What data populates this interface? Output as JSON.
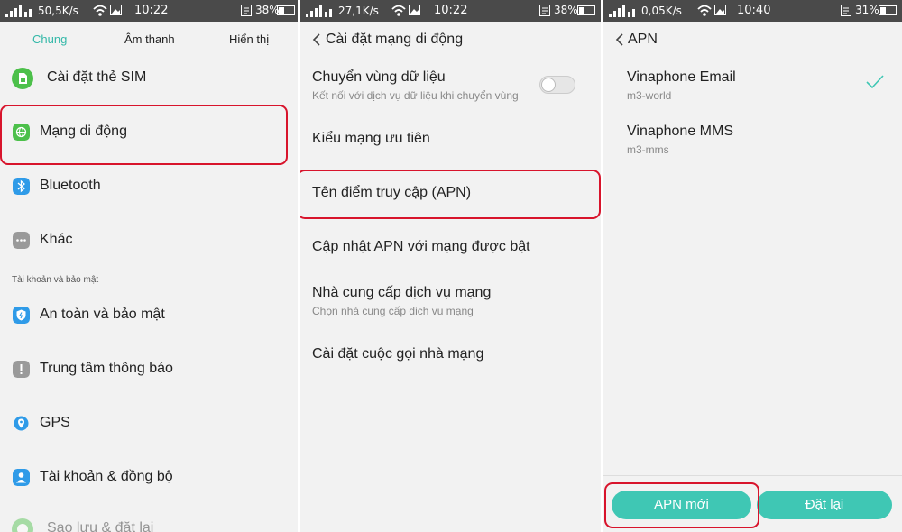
{
  "panels": [
    {
      "status": {
        "net": "50,5K/s",
        "time": "10:22",
        "battery": "38%"
      },
      "tabs": [
        {
          "label": "Chung",
          "active": true
        },
        {
          "label": "Âm thanh",
          "active": false
        },
        {
          "label": "Hiển thị",
          "active": false
        }
      ],
      "items": [
        {
          "label": "Cài đặt thẻ SIM",
          "icon": "sim-icon",
          "color": "#4cc04a"
        },
        {
          "label": "Mạng di động",
          "icon": "globe-icon",
          "color": "#4cc04a"
        },
        {
          "label": "Bluetooth",
          "icon": "bluetooth-icon",
          "color": "#2f9be8"
        },
        {
          "label": "Khác",
          "icon": "more-icon",
          "color": "#9a9a9a"
        }
      ],
      "section_header": "Tài khoản và bảo mật",
      "items2": [
        {
          "label": "An toàn và bảo mật",
          "icon": "shield-icon",
          "color": "#2f9be8"
        },
        {
          "label": "Trung tâm thông báo",
          "icon": "notice-icon",
          "color": "#9a9a9a"
        },
        {
          "label": "GPS",
          "icon": "location-icon",
          "color": "#2f9be8"
        },
        {
          "label": "Tài khoản & đồng bộ",
          "icon": "account-icon",
          "color": "#2f9be8"
        },
        {
          "label": "Sao lưu & đặt lại",
          "icon": "backup-icon",
          "color": "#4cc04a"
        }
      ]
    },
    {
      "status": {
        "net": "27,1K/s",
        "time": "10:22",
        "battery": "38%"
      },
      "title": "Cài đặt mạng di động",
      "items": [
        {
          "label": "Chuyển vùng dữ liệu",
          "sub": "Kết nối với dịch vụ dữ liệu khi chuyển vùng"
        },
        {
          "label": "Kiểu mạng ưu tiên"
        },
        {
          "label": "Tên điểm truy cập (APN)"
        },
        {
          "label": "Cập nhật APN với mạng được bật"
        },
        {
          "label": "Nhà cung cấp dịch vụ mạng",
          "sub": "Chọn nhà cung cấp dịch vụ mạng"
        },
        {
          "label": "Cài đặt cuộc gọi nhà mạng"
        }
      ]
    },
    {
      "status": {
        "net": "0,05K/s",
        "time": "10:40",
        "battery": "31%"
      },
      "title": "APN",
      "items": [
        {
          "label": "Vinaphone Email",
          "sub": "m3-world",
          "selected": true
        },
        {
          "label": "Vinaphone MMS",
          "sub": "m3-mms"
        }
      ],
      "buttons": {
        "new": "APN mới",
        "reset": "Đặt lại"
      }
    }
  ],
  "colors": {
    "accent": "#3fc7b4",
    "highlight": "#d8142c"
  }
}
